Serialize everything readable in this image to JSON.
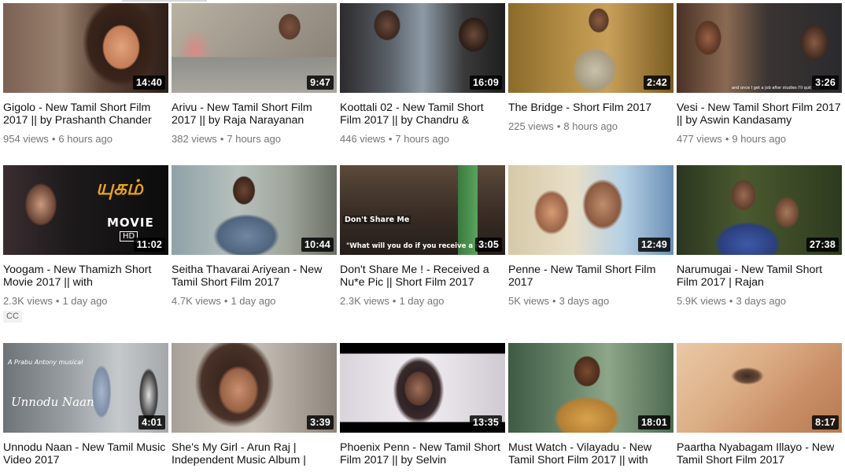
{
  "videos": [
    {
      "title": "Gigolo - New Tamil Short Film 2017 || by Prashanth Chander",
      "views": "954 views",
      "age": "6 hours ago",
      "duration": "14:40",
      "badge": null
    },
    {
      "title": "Arivu - New Tamil Short Film 2017 || by Raja Narayanan",
      "views": "382 views",
      "age": "7 hours ago",
      "duration": "9:47",
      "badge": null
    },
    {
      "title": "Koottali 02 - New Tamil Short Film 2017 || by Chandru &",
      "views": "446 views",
      "age": "7 hours ago",
      "duration": "16:09",
      "badge": null
    },
    {
      "title": "The Bridge - Short Film 2017",
      "views": "225 views",
      "age": "8 hours ago",
      "duration": "2:42",
      "badge": null
    },
    {
      "title": "Vesi - New Tamil Short Film 2017 || by Aswin Kandasamy",
      "views": "477 views",
      "age": "9 hours ago",
      "duration": "3:26",
      "badge": null
    },
    {
      "title": "Yoogam - New Thamizh Short Movie 2017 || with",
      "views": "2.3K views",
      "age": "1 day ago",
      "duration": "11:02",
      "badge": "CC"
    },
    {
      "title": "Seitha Thavarai Ariyean - New Tamil Short Film 2017",
      "views": "4.7K views",
      "age": "1 day ago",
      "duration": "10:44",
      "badge": null
    },
    {
      "title": "Don't Share Me ! - Received a Nu*e Pic || Short Film 2017",
      "views": "2.3K views",
      "age": "1 day ago",
      "duration": "3:05",
      "badge": null
    },
    {
      "title": "Penne - New Tamil Short Film 2017",
      "views": "5K views",
      "age": "3 days ago",
      "duration": "12:49",
      "badge": null
    },
    {
      "title": "Narumugai - New Tamil Short Film 2017 | Rajan",
      "views": "5.9K views",
      "age": "3 days ago",
      "duration": "27:38",
      "badge": null
    },
    {
      "title": "Unnodu Naan - New Tamil Music Video 2017",
      "views": "",
      "age": "",
      "duration": "4:01",
      "badge": null
    },
    {
      "title": "She's My Girl - Arun Raj | Independent Music Album |",
      "views": "",
      "age": "",
      "duration": "3:39",
      "badge": null
    },
    {
      "title": "Phoenix Penn - New Tamil Short Film 2017 || by Selvin",
      "views": "",
      "age": "",
      "duration": "13:35",
      "badge": null
    },
    {
      "title": "Must Watch - Vilayadu - New Tamil Short Film 2017 || with",
      "views": "",
      "age": "",
      "duration": "18:01",
      "badge": null
    },
    {
      "title": "Paartha Nyabagam Illayo - New Tamil Short Film 2017",
      "views": "",
      "age": "",
      "duration": "8:17",
      "badge": null
    }
  ],
  "thumb_texts": {
    "movie": "MOVIE",
    "hd": "HD",
    "dont_share": "Don't Share Me",
    "receive_caption": "\"What will you do if you receive a nude\"",
    "vesi_caption": "and once I get a job after studies I'll quit this.",
    "prabu_credit": "A Prabu Antony musical",
    "unnodu_logo": "Unnodu Naan"
  },
  "separator": "•"
}
